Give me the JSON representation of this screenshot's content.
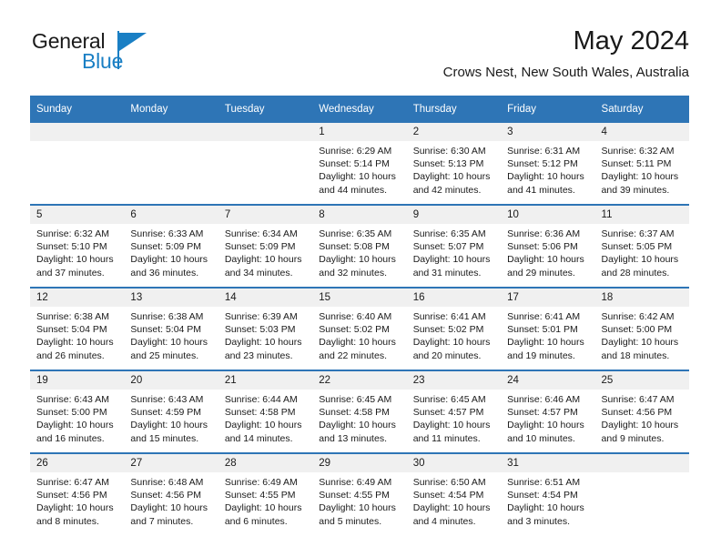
{
  "brand": {
    "name_part1": "General",
    "name_part2": "Blue",
    "logo_icon": "blue-triangle-flag-icon",
    "accent_color": "#1a7fc4"
  },
  "header": {
    "month_title": "May 2024",
    "location": "Crows Nest, New South Wales, Australia"
  },
  "theme": {
    "header_blue": "#2e75b6",
    "daynum_band": "#f0f0f0",
    "text": "#1a1a1a"
  },
  "calendar": {
    "weekday_headers": [
      "Sunday",
      "Monday",
      "Tuesday",
      "Wednesday",
      "Thursday",
      "Friday",
      "Saturday"
    ],
    "weeks": [
      [
        {
          "day": "",
          "blank": true
        },
        {
          "day": "",
          "blank": true
        },
        {
          "day": "",
          "blank": true
        },
        {
          "day": "1",
          "sunrise": "Sunrise: 6:29 AM",
          "sunset": "Sunset: 5:14 PM",
          "daylight1": "Daylight: 10 hours",
          "daylight2": "and 44 minutes."
        },
        {
          "day": "2",
          "sunrise": "Sunrise: 6:30 AM",
          "sunset": "Sunset: 5:13 PM",
          "daylight1": "Daylight: 10 hours",
          "daylight2": "and 42 minutes."
        },
        {
          "day": "3",
          "sunrise": "Sunrise: 6:31 AM",
          "sunset": "Sunset: 5:12 PM",
          "daylight1": "Daylight: 10 hours",
          "daylight2": "and 41 minutes."
        },
        {
          "day": "4",
          "sunrise": "Sunrise: 6:32 AM",
          "sunset": "Sunset: 5:11 PM",
          "daylight1": "Daylight: 10 hours",
          "daylight2": "and 39 minutes."
        }
      ],
      [
        {
          "day": "5",
          "sunrise": "Sunrise: 6:32 AM",
          "sunset": "Sunset: 5:10 PM",
          "daylight1": "Daylight: 10 hours",
          "daylight2": "and 37 minutes."
        },
        {
          "day": "6",
          "sunrise": "Sunrise: 6:33 AM",
          "sunset": "Sunset: 5:09 PM",
          "daylight1": "Daylight: 10 hours",
          "daylight2": "and 36 minutes."
        },
        {
          "day": "7",
          "sunrise": "Sunrise: 6:34 AM",
          "sunset": "Sunset: 5:09 PM",
          "daylight1": "Daylight: 10 hours",
          "daylight2": "and 34 minutes."
        },
        {
          "day": "8",
          "sunrise": "Sunrise: 6:35 AM",
          "sunset": "Sunset: 5:08 PM",
          "daylight1": "Daylight: 10 hours",
          "daylight2": "and 32 minutes."
        },
        {
          "day": "9",
          "sunrise": "Sunrise: 6:35 AM",
          "sunset": "Sunset: 5:07 PM",
          "daylight1": "Daylight: 10 hours",
          "daylight2": "and 31 minutes."
        },
        {
          "day": "10",
          "sunrise": "Sunrise: 6:36 AM",
          "sunset": "Sunset: 5:06 PM",
          "daylight1": "Daylight: 10 hours",
          "daylight2": "and 29 minutes."
        },
        {
          "day": "11",
          "sunrise": "Sunrise: 6:37 AM",
          "sunset": "Sunset: 5:05 PM",
          "daylight1": "Daylight: 10 hours",
          "daylight2": "and 28 minutes."
        }
      ],
      [
        {
          "day": "12",
          "sunrise": "Sunrise: 6:38 AM",
          "sunset": "Sunset: 5:04 PM",
          "daylight1": "Daylight: 10 hours",
          "daylight2": "and 26 minutes."
        },
        {
          "day": "13",
          "sunrise": "Sunrise: 6:38 AM",
          "sunset": "Sunset: 5:04 PM",
          "daylight1": "Daylight: 10 hours",
          "daylight2": "and 25 minutes."
        },
        {
          "day": "14",
          "sunrise": "Sunrise: 6:39 AM",
          "sunset": "Sunset: 5:03 PM",
          "daylight1": "Daylight: 10 hours",
          "daylight2": "and 23 minutes."
        },
        {
          "day": "15",
          "sunrise": "Sunrise: 6:40 AM",
          "sunset": "Sunset: 5:02 PM",
          "daylight1": "Daylight: 10 hours",
          "daylight2": "and 22 minutes."
        },
        {
          "day": "16",
          "sunrise": "Sunrise: 6:41 AM",
          "sunset": "Sunset: 5:02 PM",
          "daylight1": "Daylight: 10 hours",
          "daylight2": "and 20 minutes."
        },
        {
          "day": "17",
          "sunrise": "Sunrise: 6:41 AM",
          "sunset": "Sunset: 5:01 PM",
          "daylight1": "Daylight: 10 hours",
          "daylight2": "and 19 minutes."
        },
        {
          "day": "18",
          "sunrise": "Sunrise: 6:42 AM",
          "sunset": "Sunset: 5:00 PM",
          "daylight1": "Daylight: 10 hours",
          "daylight2": "and 18 minutes."
        }
      ],
      [
        {
          "day": "19",
          "sunrise": "Sunrise: 6:43 AM",
          "sunset": "Sunset: 5:00 PM",
          "daylight1": "Daylight: 10 hours",
          "daylight2": "and 16 minutes."
        },
        {
          "day": "20",
          "sunrise": "Sunrise: 6:43 AM",
          "sunset": "Sunset: 4:59 PM",
          "daylight1": "Daylight: 10 hours",
          "daylight2": "and 15 minutes."
        },
        {
          "day": "21",
          "sunrise": "Sunrise: 6:44 AM",
          "sunset": "Sunset: 4:58 PM",
          "daylight1": "Daylight: 10 hours",
          "daylight2": "and 14 minutes."
        },
        {
          "day": "22",
          "sunrise": "Sunrise: 6:45 AM",
          "sunset": "Sunset: 4:58 PM",
          "daylight1": "Daylight: 10 hours",
          "daylight2": "and 13 minutes."
        },
        {
          "day": "23",
          "sunrise": "Sunrise: 6:45 AM",
          "sunset": "Sunset: 4:57 PM",
          "daylight1": "Daylight: 10 hours",
          "daylight2": "and 11 minutes."
        },
        {
          "day": "24",
          "sunrise": "Sunrise: 6:46 AM",
          "sunset": "Sunset: 4:57 PM",
          "daylight1": "Daylight: 10 hours",
          "daylight2": "and 10 minutes."
        },
        {
          "day": "25",
          "sunrise": "Sunrise: 6:47 AM",
          "sunset": "Sunset: 4:56 PM",
          "daylight1": "Daylight: 10 hours",
          "daylight2": "and 9 minutes."
        }
      ],
      [
        {
          "day": "26",
          "sunrise": "Sunrise: 6:47 AM",
          "sunset": "Sunset: 4:56 PM",
          "daylight1": "Daylight: 10 hours",
          "daylight2": "and 8 minutes."
        },
        {
          "day": "27",
          "sunrise": "Sunrise: 6:48 AM",
          "sunset": "Sunset: 4:56 PM",
          "daylight1": "Daylight: 10 hours",
          "daylight2": "and 7 minutes."
        },
        {
          "day": "28",
          "sunrise": "Sunrise: 6:49 AM",
          "sunset": "Sunset: 4:55 PM",
          "daylight1": "Daylight: 10 hours",
          "daylight2": "and 6 minutes."
        },
        {
          "day": "29",
          "sunrise": "Sunrise: 6:49 AM",
          "sunset": "Sunset: 4:55 PM",
          "daylight1": "Daylight: 10 hours",
          "daylight2": "and 5 minutes."
        },
        {
          "day": "30",
          "sunrise": "Sunrise: 6:50 AM",
          "sunset": "Sunset: 4:54 PM",
          "daylight1": "Daylight: 10 hours",
          "daylight2": "and 4 minutes."
        },
        {
          "day": "31",
          "sunrise": "Sunrise: 6:51 AM",
          "sunset": "Sunset: 4:54 PM",
          "daylight1": "Daylight: 10 hours",
          "daylight2": "and 3 minutes."
        },
        {
          "day": "",
          "blank": true
        }
      ]
    ]
  }
}
